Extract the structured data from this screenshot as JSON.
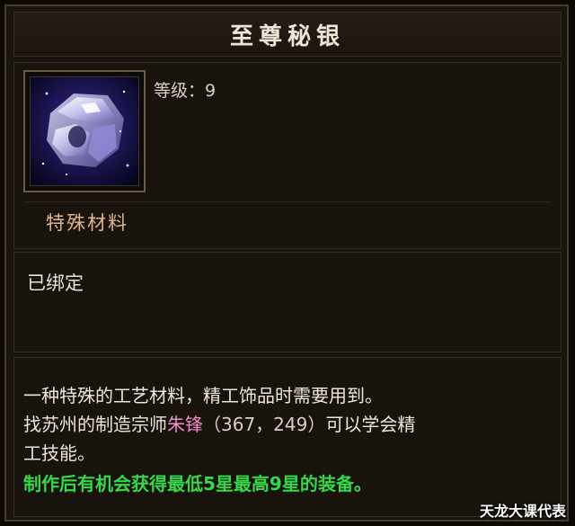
{
  "item": {
    "name": "至尊秘银",
    "level_label": "等级：9",
    "category": "特殊材料",
    "bind_status": "已绑定",
    "icon": "silver-ore-icon"
  },
  "description": {
    "line1": "一种特殊的工艺材料，精工饰品时需要用到。",
    "line2_prefix": "找苏州的制造宗师",
    "npc_name": "朱锋",
    "coords": "（367，249）",
    "line2_suffix": "可以学会精",
    "line3": "工技能。",
    "bonus_line": "制作后有机会获得最低5星最高9星的装备。"
  },
  "colors": {
    "npc_name": "#f08acb",
    "bonus_text": "#35d84a",
    "category_text": "#e0b48c"
  },
  "watermark": "天龙大课代表"
}
